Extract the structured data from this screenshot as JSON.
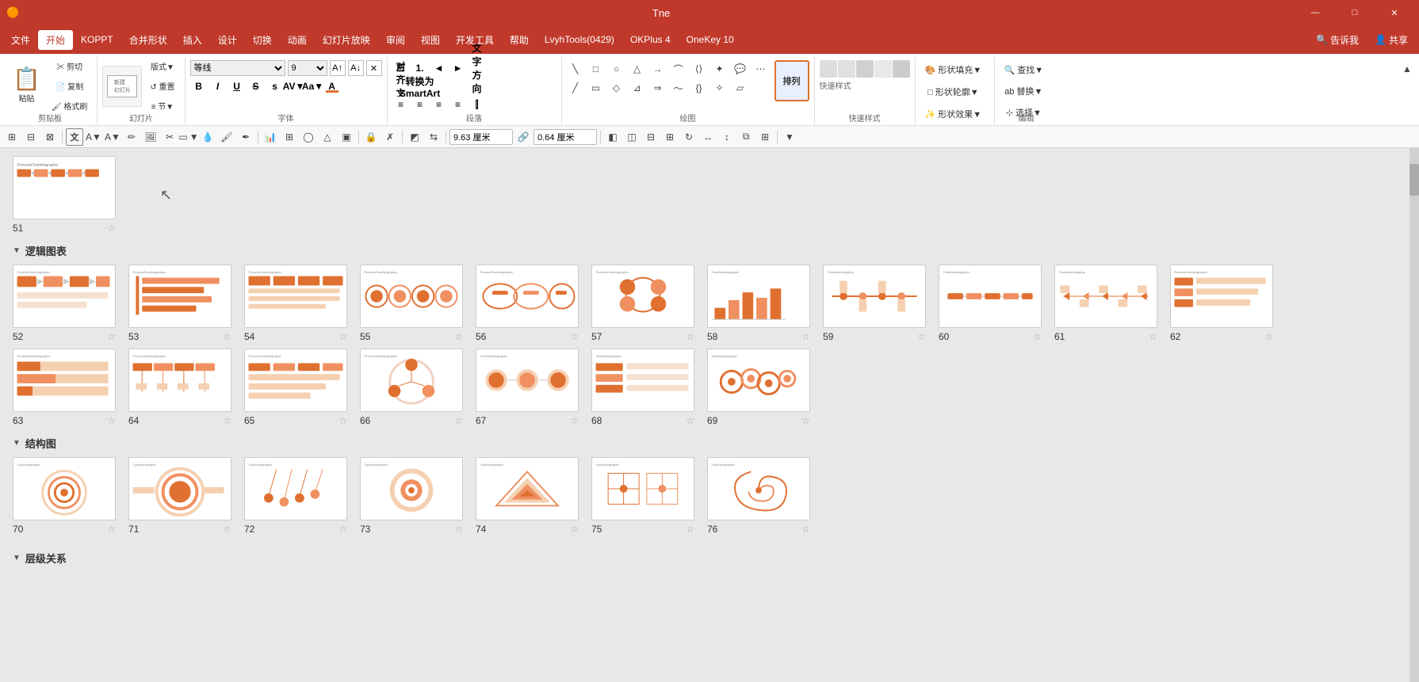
{
  "titlebar": {
    "title": "Tne",
    "minimize": "—",
    "maximize": "□",
    "close": "✕"
  },
  "menubar": {
    "items": [
      "文件",
      "开始",
      "KOPPT",
      "合并形状",
      "插入",
      "设计",
      "切换",
      "动画",
      "幻灯片放映",
      "审阅",
      "视图",
      "开发工具",
      "帮助",
      "LvyhTools(0429)",
      "OKPlus 4",
      "OneKey 10",
      "告诉我",
      "共享"
    ]
  },
  "ribbon": {
    "groups": [
      {
        "label": "剪贴板",
        "id": "clipboard"
      },
      {
        "label": "幻灯片",
        "id": "slide"
      },
      {
        "label": "字体",
        "id": "font"
      },
      {
        "label": "段落",
        "id": "paragraph"
      },
      {
        "label": "绘图",
        "id": "drawing"
      },
      {
        "label": "快速样式",
        "id": "styles"
      },
      {
        "label": "形状填充",
        "id": "shapefill"
      },
      {
        "label": "编辑",
        "id": "edit"
      }
    ],
    "font_name": "等线",
    "font_size": "9",
    "width_input": "9.63 厘米",
    "height_input": "0.64 厘米"
  },
  "sections": [
    {
      "id": "logic",
      "label": "逻辑图表",
      "slides": [
        {
          "num": 52,
          "starred": false
        },
        {
          "num": 53,
          "starred": false
        },
        {
          "num": 54,
          "starred": false
        },
        {
          "num": 55,
          "starred": false
        },
        {
          "num": 56,
          "starred": false
        },
        {
          "num": 57,
          "starred": false
        },
        {
          "num": 58,
          "starred": false
        },
        {
          "num": 59,
          "starred": false
        },
        {
          "num": 60,
          "starred": false
        },
        {
          "num": 61,
          "starred": false
        },
        {
          "num": 62,
          "starred": false
        },
        {
          "num": 63,
          "starred": false
        },
        {
          "num": 64,
          "starred": false
        },
        {
          "num": 65,
          "starred": false
        },
        {
          "num": 66,
          "starred": false
        },
        {
          "num": 67,
          "starred": false
        },
        {
          "num": 68,
          "starred": false
        },
        {
          "num": 69,
          "starred": false
        }
      ]
    },
    {
      "id": "structure",
      "label": "结构图",
      "slides": [
        {
          "num": 70,
          "starred": false
        },
        {
          "num": 71,
          "starred": false
        },
        {
          "num": 72,
          "starred": false
        },
        {
          "num": 73,
          "starred": false
        },
        {
          "num": 74,
          "starred": false
        },
        {
          "num": 75,
          "starred": false
        },
        {
          "num": 76,
          "starred": false
        }
      ]
    },
    {
      "id": "hierarchy",
      "label": "层级关系",
      "slides": []
    }
  ],
  "slide51": {
    "num": 51,
    "starred": false
  },
  "cursor": "►"
}
